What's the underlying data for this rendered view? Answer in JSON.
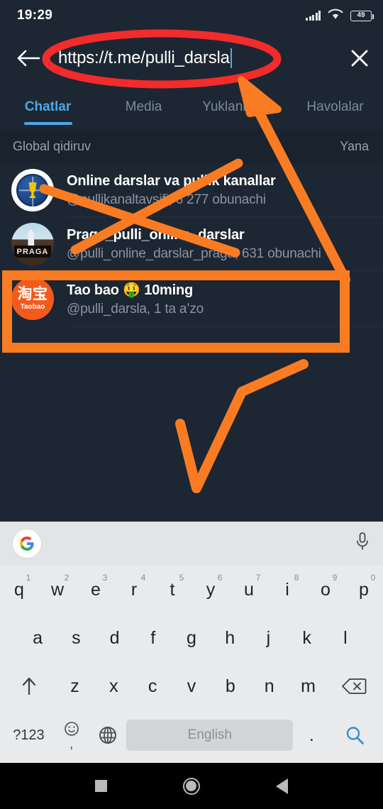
{
  "status_bar": {
    "time": "19:29",
    "battery_level": "49",
    "icons": [
      "signal-icon",
      "wifi-icon",
      "battery-icon"
    ]
  },
  "search": {
    "value": "https://t.me/pulli_darsla",
    "back_icon": "back-arrow-icon",
    "clear_icon": "close-icon"
  },
  "tabs": [
    {
      "label": "Chatlar",
      "active": true
    },
    {
      "label": "Media",
      "active": false
    },
    {
      "label": "Yuklanmalar",
      "active": false
    },
    {
      "label": "Havolalar",
      "active": false
    }
  ],
  "section": {
    "title": "Global qidiruv",
    "more": "Yana"
  },
  "results": [
    {
      "title": "Online darslar va pullik kanallar",
      "subtitle": "@pullikanaltavsifi, 6 277 obunachi",
      "avatar": "prezident-maktabi-emblem"
    },
    {
      "title": "Praga_pulli_online_darslar",
      "subtitle": "@pulli_online_darslar_praga, 631 obunachi",
      "avatar": "praga-photo",
      "avatar_text": "PRAGA"
    },
    {
      "title": "Tao bao 🤑 10ming",
      "subtitle": "@pulli_darsla, 1 ta a’zo",
      "avatar": "taobao-logo",
      "avatar_cn": "淘宝",
      "avatar_en": "Taobao",
      "highlighted": true
    }
  ],
  "keyboard": {
    "suggestion_bar": {
      "left_icon": "google-g-icon",
      "right_icon": "microphone-icon"
    },
    "row1": [
      {
        "key": "q",
        "num": "1"
      },
      {
        "key": "w",
        "num": "2"
      },
      {
        "key": "e",
        "num": "3"
      },
      {
        "key": "r",
        "num": "4"
      },
      {
        "key": "t",
        "num": "5"
      },
      {
        "key": "y",
        "num": "6"
      },
      {
        "key": "u",
        "num": "7"
      },
      {
        "key": "i",
        "num": "8"
      },
      {
        "key": "o",
        "num": "9"
      },
      {
        "key": "p",
        "num": "0"
      }
    ],
    "row2": [
      "a",
      "s",
      "d",
      "f",
      "g",
      "h",
      "j",
      "k",
      "l"
    ],
    "row3": [
      "z",
      "x",
      "c",
      "v",
      "b",
      "n",
      "m"
    ],
    "shift_icon": "shift-arrow-icon",
    "backspace_icon": "backspace-icon",
    "symbols_label": "?123",
    "emoji_icon": "emoji-icon",
    "comma_label": ",",
    "language_icon": "globe-icon",
    "space_label": "English",
    "period_label": ".",
    "search_icon": "search-icon"
  },
  "nav_bar": {
    "recents_icon": "square-recents-icon",
    "home_icon": "circle-home-icon",
    "back_icon": "triangle-back-icon"
  },
  "annotations": {
    "colors": {
      "circle": "#f22b2b",
      "marker": "#f97c23"
    },
    "shapes": [
      "red-ellipse-around-search-field",
      "orange-arrow-pointing-to-search-field",
      "orange-cross-over-first-two-results",
      "orange-rectangle-around-third-result",
      "orange-checkmark-below-results"
    ]
  }
}
